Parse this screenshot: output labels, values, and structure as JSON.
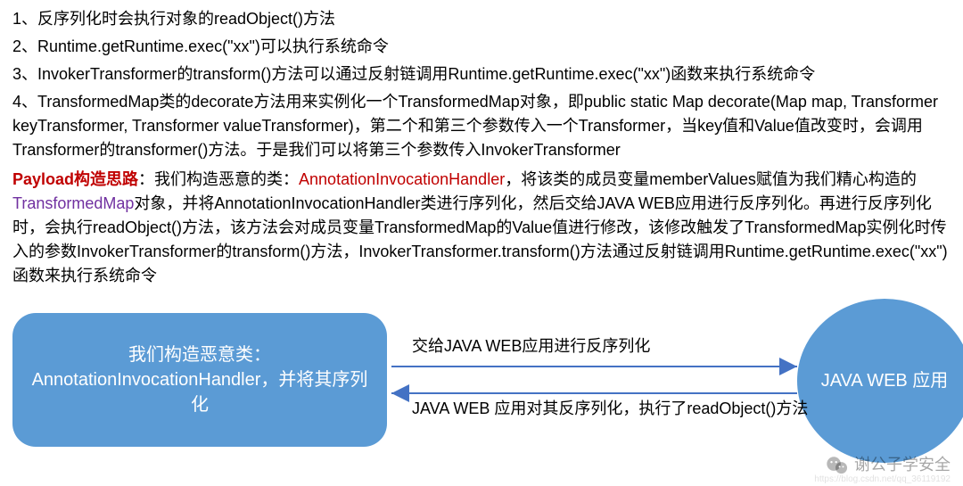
{
  "points": {
    "p1": "1、反序列化时会执行对象的readObject()方法",
    "p2": "2、Runtime.getRuntime.exec(\"xx\")可以执行系统命令",
    "p3": "3、InvokerTransformer的transform()方法可以通过反射链调用Runtime.getRuntime.exec(\"xx\")函数来执行系统命令",
    "p4": "4、TransformedMap类的decorate方法用来实例化一个TransformedMap对象，即public static Map decorate(Map map, Transformer keyTransformer, Transformer valueTransformer)，第二个和第三个参数传入一个Transformer，当key值和Value值改变时，会调用Transformer的transformer()方法。于是我们可以将第三个参数传入InvokerTransformer"
  },
  "payload": {
    "label": "Payload构造思路",
    "seg1": "：我们构造恶意的类：",
    "aih": "AnnotationInvocationHandler",
    "seg2": "，将该类的成员变量memberValues赋值为我们精心构造的",
    "tmap": "TransformedMap",
    "seg3": "对象，并将AnnotationInvocationHandler类进行序列化，然后交给JAVA WEB应用进行反序列化。再进行反序列化时，会执行readObject()方法，该方法会对成员变量TransformedMap的Value值进行修改，该修改触发了TransformedMap实例化时传入的参数InvokerTransformer的transform()方法，InvokerTransformer.transform()方法通过反射链调用Runtime.getRuntime.exec(\"xx\")函数来执行系统命令"
  },
  "diagram": {
    "left_node": "我们构造恶意类：AnnotationInvocationHandler，并将其序列化",
    "right_node": "JAVA WEB 应用",
    "arrow_top": "交给JAVA WEB应用进行反序列化",
    "arrow_bot": "JAVA WEB 应用对其反序列化，执行了readObject()方法"
  },
  "watermark": "谢公子学安全",
  "tinylink": "https://blog.csdn.net/qq_36119192",
  "colors": {
    "shape_fill": "#5b9bd5",
    "arrow_stroke": "#4472c4"
  }
}
